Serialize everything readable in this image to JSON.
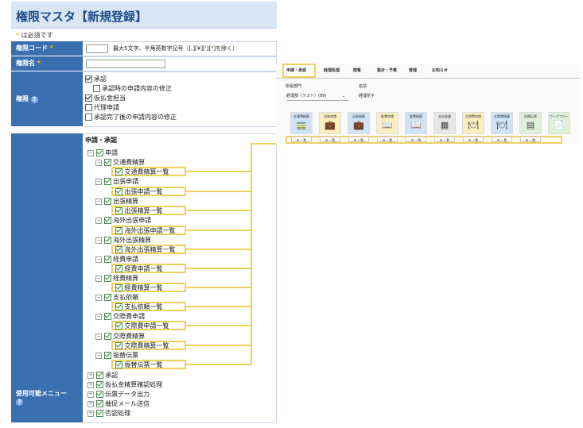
{
  "title": "権限マスタ【新規登録】",
  "required_note": {
    "mark": "*",
    "text": " は必須です"
  },
  "fields": {
    "code_label": "権限コード",
    "code_hint": "最大5文字、半角英数字記号（[,][¥]['][\"]を除く）",
    "name_label": "権限名",
    "perm_label": "権限",
    "required_mark": "*",
    "help_mark": "?"
  },
  "permissions": [
    {
      "label": "承認",
      "checked": true
    },
    {
      "label": "承認時の申請内容の修正",
      "checked": false
    },
    {
      "label": "仮払金担当",
      "checked": true
    },
    {
      "label": "代理申請",
      "checked": false
    },
    {
      "label": "承認完了後の申請内容の修正",
      "checked": false
    }
  ],
  "menu_label": "使用可能メニュー",
  "menu_section": "申請・承認",
  "tree": {
    "root": "申請",
    "groups": [
      {
        "name": "交通費精算",
        "item": "交通費精算一覧"
      },
      {
        "name": "出張申請",
        "item": "出張申請一覧"
      },
      {
        "name": "出張精算",
        "item": "出張精算一覧"
      },
      {
        "name": "海外出張申請",
        "item": "海外出張申請一覧"
      },
      {
        "name": "海外出張精算",
        "item": "海外出張精算一覧"
      },
      {
        "name": "経費申請",
        "item": "経費申請一覧"
      },
      {
        "name": "経費精算",
        "item": "経費精算一覧"
      },
      {
        "name": "支払依頼",
        "item": "支払依頼一覧"
      },
      {
        "name": "交際費申請",
        "item": "交際費申請一覧"
      },
      {
        "name": "交際費精算",
        "item": "交際費精算一覧"
      },
      {
        "name": "振替伝票",
        "item": "振替伝票一覧"
      }
    ],
    "others": [
      "承認",
      "仮払金精算確認処理",
      "伝票データ出力",
      "催促メール送信",
      "否認処理"
    ]
  },
  "panel": {
    "tabs": [
      "申請・承認",
      "経理処理",
      "閲覧",
      "集計・予算",
      "管理",
      "お知らせ"
    ],
    "dept_label": "所属部門",
    "dept_value": "経理部（テスト）(99)",
    "name_label": "名前",
    "name_value": "経理花子",
    "tiles": [
      {
        "label": "交通費精算",
        "icon": "🚃"
      },
      {
        "label": "出張申請",
        "icon": "💼"
      },
      {
        "label": "出張精算",
        "icon": "💼"
      },
      {
        "label": "経費申請",
        "icon": "📖"
      },
      {
        "label": "経費精算",
        "icon": "📖"
      },
      {
        "label": "支払依頼",
        "icon": "▦"
      },
      {
        "label": "交際費申請",
        "icon": "🍽"
      },
      {
        "label": "交際費精算",
        "icon": "🍽"
      },
      {
        "label": "振替伝票",
        "icon": "▤"
      },
      {
        "label": "ワークフロー",
        "icon": "📄"
      }
    ],
    "list_button": "☰ 一覧",
    "colors": {
      "tab_highlight": "#f0d060",
      "tile_blue": "#cfe3f7",
      "tile_yellow": "#fbeec0",
      "tile_gray": "#e6e6e6",
      "tile_green": "#dff0d8"
    }
  }
}
